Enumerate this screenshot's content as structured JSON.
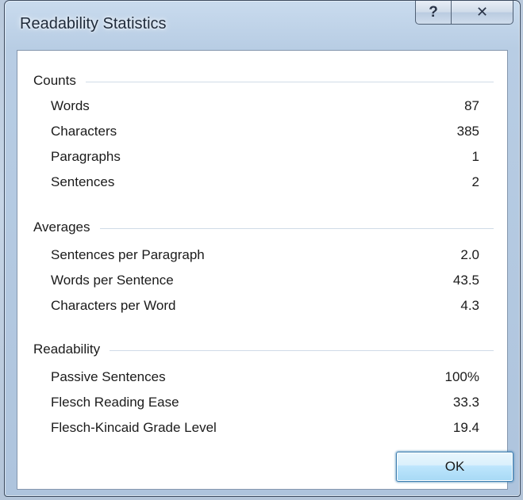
{
  "window": {
    "title": "Readability Statistics",
    "help_glyph": "?",
    "close_glyph": "✕"
  },
  "sections": [
    {
      "title": "Counts",
      "rows": [
        {
          "label": "Words",
          "value": "87"
        },
        {
          "label": "Characters",
          "value": "385"
        },
        {
          "label": "Paragraphs",
          "value": "1"
        },
        {
          "label": "Sentences",
          "value": "2"
        }
      ]
    },
    {
      "title": "Averages",
      "rows": [
        {
          "label": "Sentences per Paragraph",
          "value": "2.0"
        },
        {
          "label": "Words per Sentence",
          "value": "43.5"
        },
        {
          "label": "Characters per Word",
          "value": "4.3"
        }
      ]
    },
    {
      "title": "Readability",
      "rows": [
        {
          "label": "Passive Sentences",
          "value": "100%"
        },
        {
          "label": "Flesch Reading Ease",
          "value": "33.3"
        },
        {
          "label": "Flesch-Kincaid Grade Level",
          "value": "19.4"
        }
      ]
    }
  ],
  "buttons": {
    "ok_label": "OK"
  },
  "icons": {
    "help": "help-icon",
    "close": "close-icon"
  }
}
